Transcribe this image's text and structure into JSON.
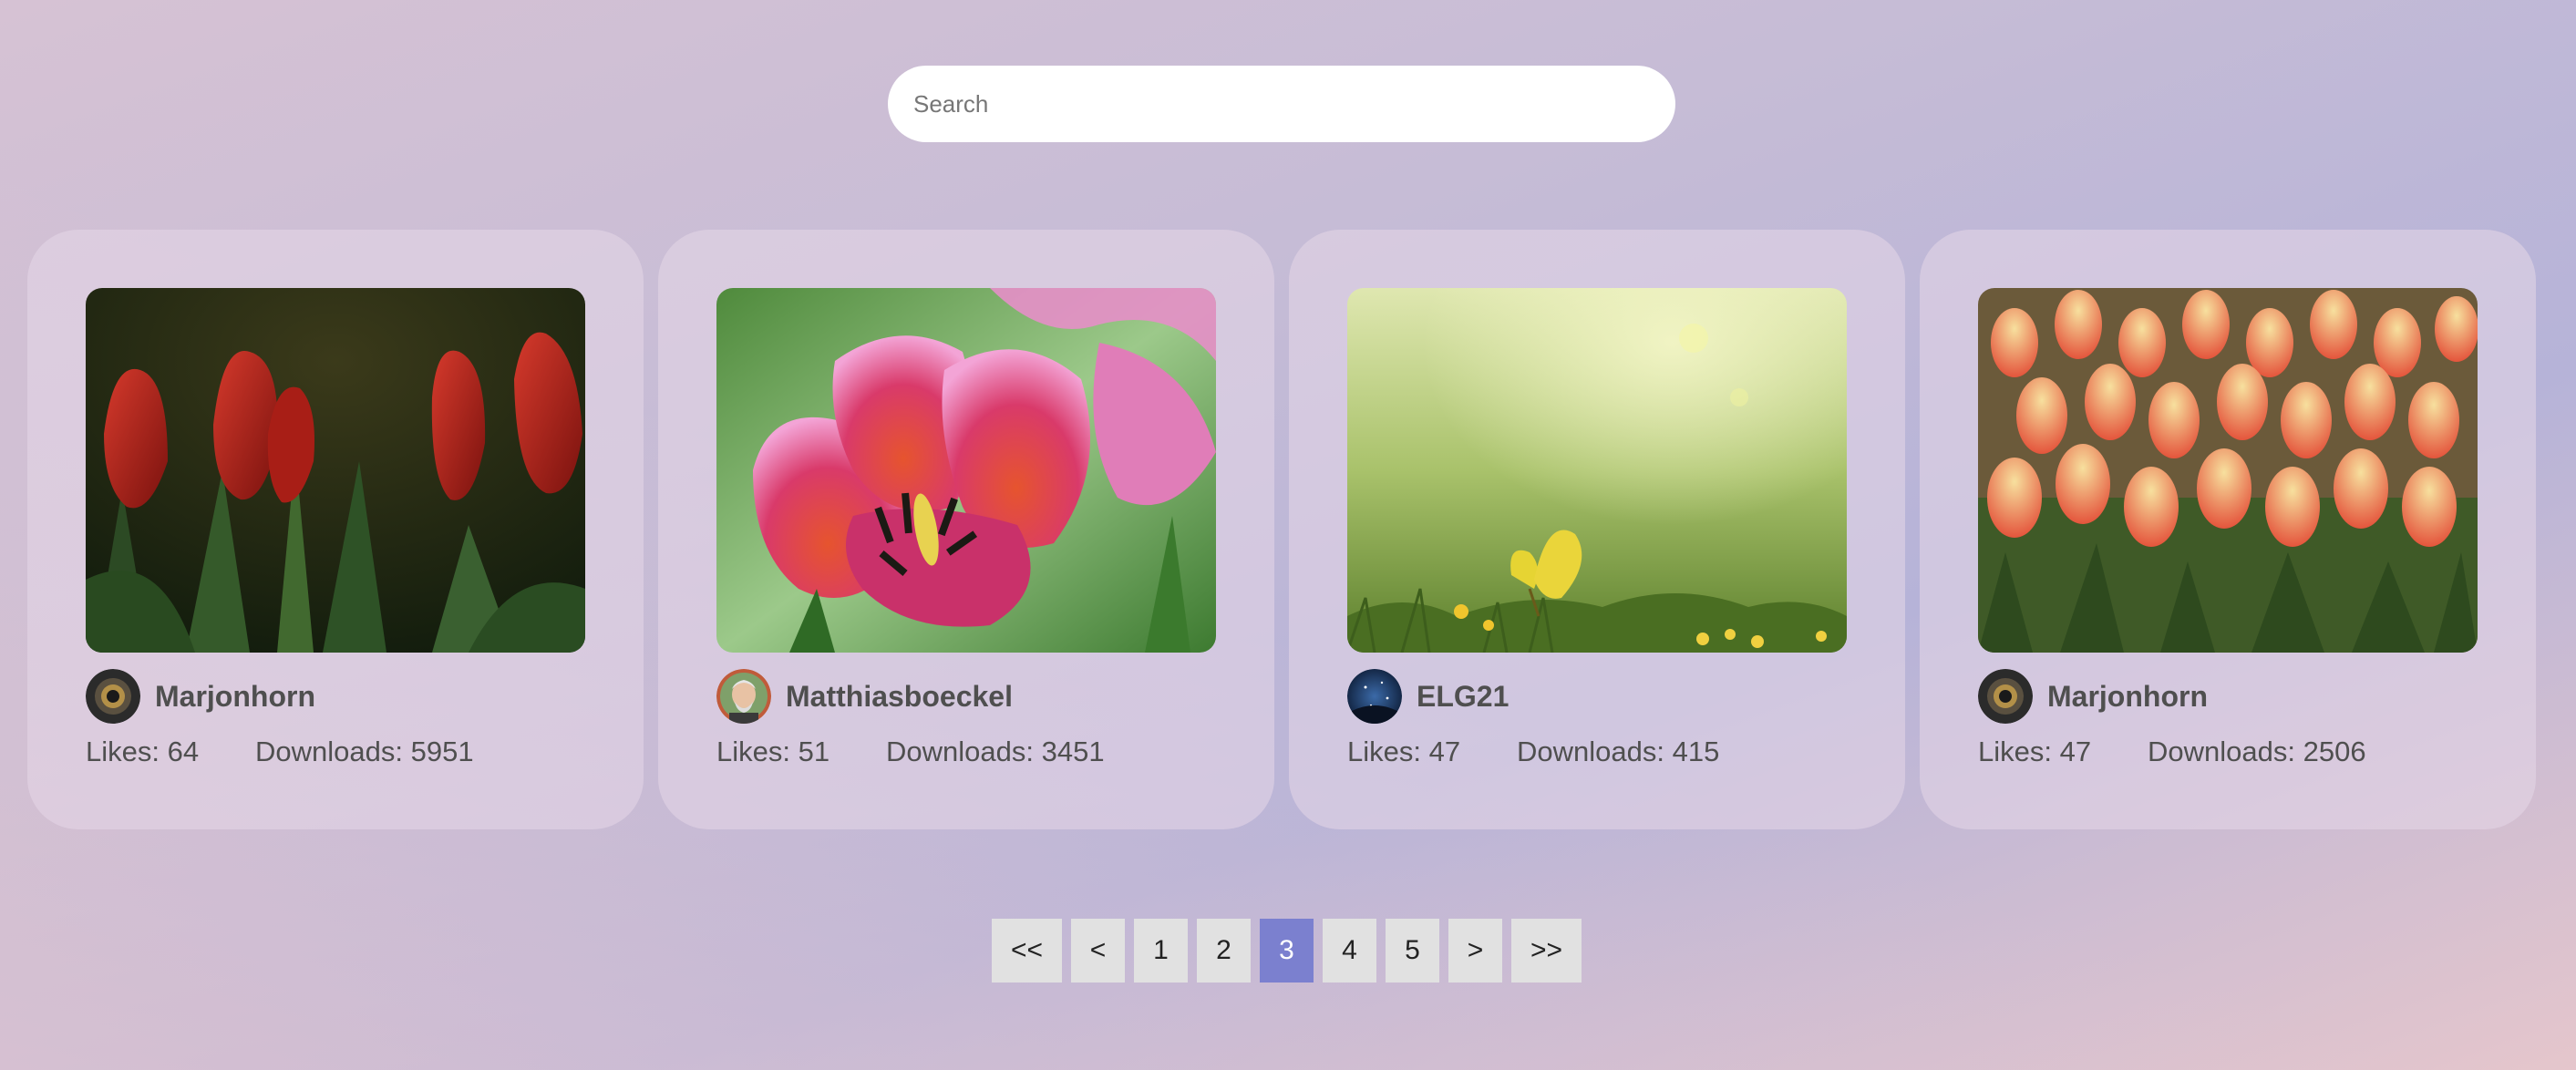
{
  "search": {
    "placeholder": "Search",
    "value": ""
  },
  "cards": [
    {
      "image_subject": "red tulips",
      "author": "Marjonhorn",
      "avatar_icon": "camera-lens-avatar",
      "likes": "Likes: 64",
      "downloads": "Downloads: 5951"
    },
    {
      "image_subject": "pink tulip",
      "author": "Matthiasboeckel",
      "avatar_icon": "person-avatar",
      "likes": "Likes: 51",
      "downloads": "Downloads: 3451"
    },
    {
      "image_subject": "yellow butterfly in meadow",
      "author": "ELG21",
      "avatar_icon": "night-sky-avatar",
      "likes": "Likes: 47",
      "downloads": "Downloads: 415"
    },
    {
      "image_subject": "striped tulips",
      "author": "Marjonhorn",
      "avatar_icon": "camera-lens-avatar",
      "likes": "Likes: 47",
      "downloads": "Downloads: 2506"
    }
  ],
  "pagination": {
    "first": "<<",
    "prev": "<",
    "pages": [
      "1",
      "2",
      "3",
      "4",
      "5"
    ],
    "current_page": "3",
    "next": ">",
    "last": ">>"
  },
  "colors": {
    "active_page": "#7b80cf",
    "page_button": "#e1e1e1",
    "text": "#4f4f4f"
  }
}
